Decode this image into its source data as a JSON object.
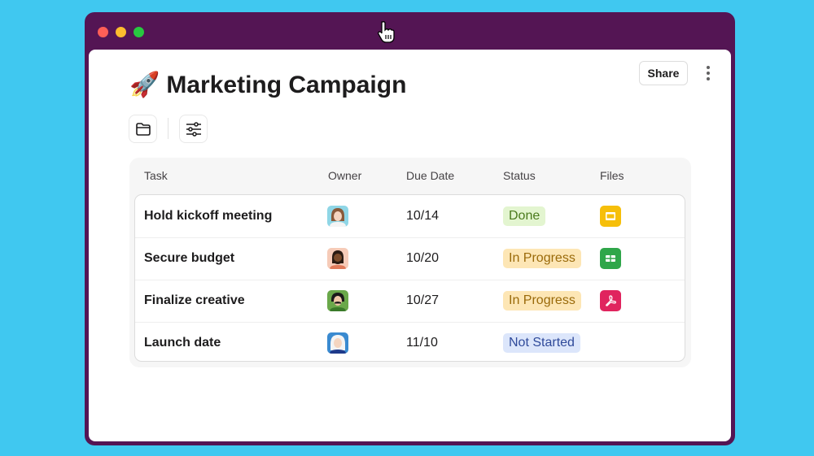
{
  "window": {
    "traffic_lights": [
      {
        "name": "close",
        "color": "#ff5f57"
      },
      {
        "name": "minimize",
        "color": "#febc2e"
      },
      {
        "name": "maximize",
        "color": "#28c840"
      }
    ]
  },
  "header": {
    "emoji": "🚀",
    "title": "Marketing Campaign",
    "share_label": "Share"
  },
  "toolbar": {
    "folder_icon": "folder-icon",
    "filter_icon": "sliders-icon"
  },
  "table": {
    "columns": [
      "Task",
      "Owner",
      "Due Date",
      "Status",
      "Files"
    ],
    "rows": [
      {
        "task": "Hold kickoff meeting",
        "owner": "avatar-woman-brown-hair",
        "due": "10/14",
        "status": "Done",
        "file": "slides-icon"
      },
      {
        "task": "Secure budget",
        "owner": "avatar-man-beard",
        "due": "10/20",
        "status": "In Progress",
        "file": "sheets-icon"
      },
      {
        "task": "Finalize creative",
        "owner": "avatar-man-mustache",
        "due": "10/27",
        "status": "In Progress",
        "file": "pdf-icon"
      },
      {
        "task": "Launch date",
        "owner": "avatar-woman-white-hair",
        "due": "11/10",
        "status": "Not Started",
        "file": ""
      }
    ]
  },
  "status_colors": {
    "Done": {
      "bg": "#e3f5d0",
      "fg": "#4a7a1c"
    },
    "In Progress": {
      "bg": "#fde6b5",
      "fg": "#9a6a0a"
    },
    "Not Started": {
      "bg": "#dce6fb",
      "fg": "#2f4a9a"
    }
  }
}
